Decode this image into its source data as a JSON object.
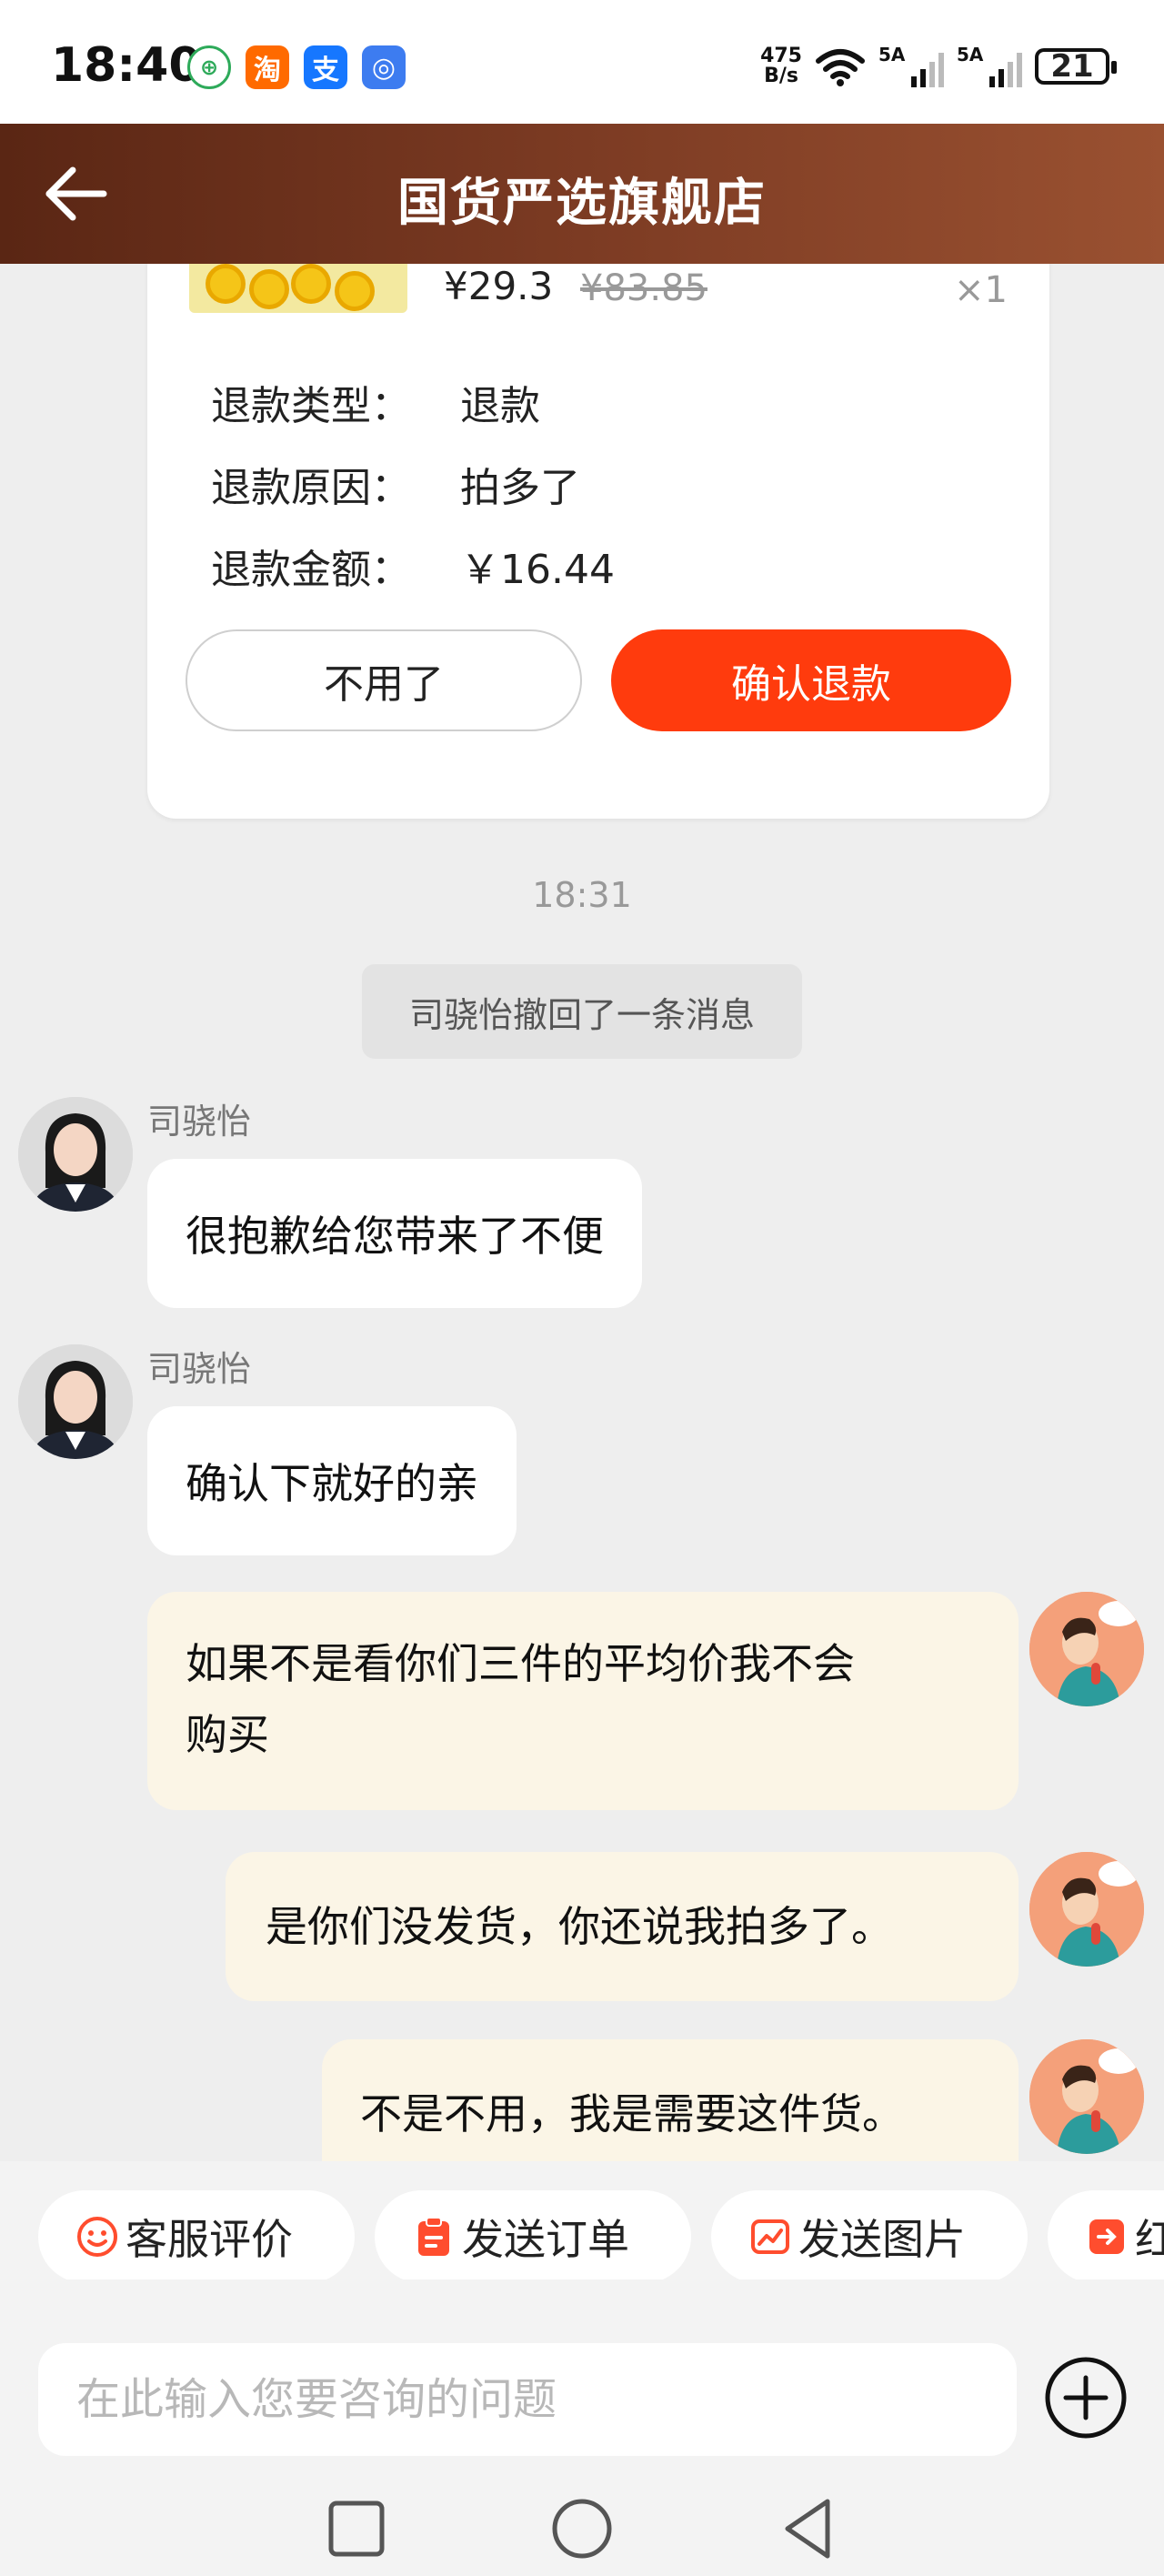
{
  "status_bar": {
    "time": "18:40",
    "app_icons": [
      {
        "name": "green-app-icon",
        "glyph": "⊕"
      },
      {
        "name": "taobao-icon",
        "glyph": "淘"
      },
      {
        "name": "alipay-icon",
        "glyph": "支"
      },
      {
        "name": "signal-app-icon",
        "glyph": "◎"
      }
    ],
    "net_speed_value": "475",
    "net_speed_unit": "B/s",
    "sim1_label": "5A",
    "sim2_label": "5A",
    "battery": "21"
  },
  "header": {
    "title": "国货严选旗舰店",
    "bg_start": "#5a2614",
    "bg_end": "#9a5131"
  },
  "refund_card": {
    "price": "¥29.3",
    "original_price": "¥83.85",
    "quantity": "×1",
    "rows": [
      {
        "label": "退款类型：",
        "value": "退款"
      },
      {
        "label": "退款原因：",
        "value": "拍多了"
      },
      {
        "label": "退款金额：",
        "value": "￥16.44"
      }
    ],
    "decline_label": "不用了",
    "confirm_label": "确认退款",
    "accent_color": "#ff3b0d"
  },
  "chat": {
    "timestamp": "18:31",
    "recall_notice": "司骁怡撤回了一条消息",
    "messages": [
      {
        "from": "agent",
        "sender": "司骁怡",
        "text": "很抱歉给您带来了不便"
      },
      {
        "from": "agent",
        "sender": "司骁怡",
        "text": "确认下就好的亲"
      },
      {
        "from": "user",
        "text_line1": "如果不是看你们三件的平均价我不会",
        "text_line2": "购买"
      },
      {
        "from": "user",
        "text": "是你们没发货，你还说我拍多了。"
      },
      {
        "from": "user",
        "text": "不是不用，我是需要这件货。"
      }
    ]
  },
  "quick_actions": [
    {
      "label": "客服评价",
      "icon": "smile-icon"
    },
    {
      "label": "发送订单",
      "icon": "clipboard-icon"
    },
    {
      "label": "发送图片",
      "icon": "image-icon"
    },
    {
      "label": "红",
      "icon": "share-icon"
    }
  ],
  "input": {
    "placeholder": "在此输入您要咨询的问题"
  },
  "nav": [
    "recents",
    "home",
    "back"
  ]
}
